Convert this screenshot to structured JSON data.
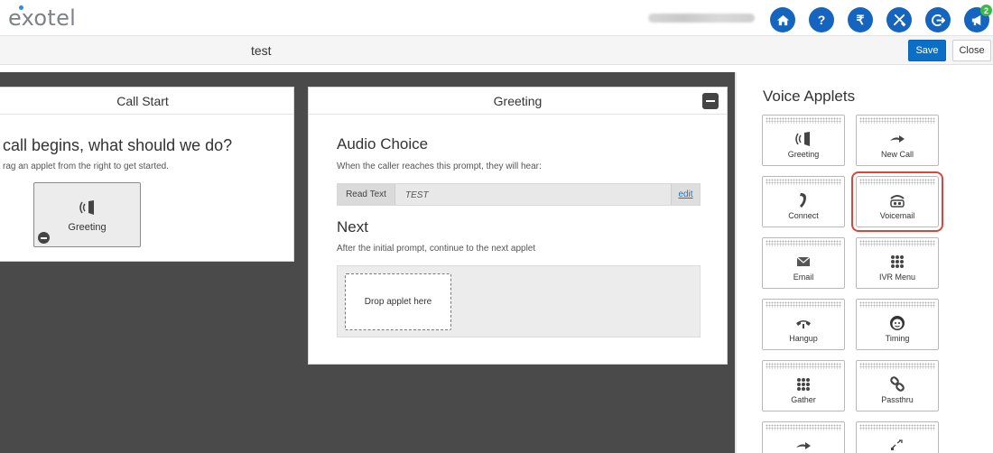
{
  "header": {
    "logo_text": "exotel",
    "user_name": "redacted user name",
    "icons": [
      {
        "name": "home-icon",
        "glyph": "home"
      },
      {
        "name": "help-icon",
        "glyph": "?"
      },
      {
        "name": "rupee-icon",
        "glyph": "₹"
      },
      {
        "name": "tools-icon",
        "glyph": "tools"
      },
      {
        "name": "logout-icon",
        "glyph": "logout"
      },
      {
        "name": "announcement-icon",
        "glyph": "megaphone",
        "badge": "2"
      }
    ],
    "accent_color": "#1565c0"
  },
  "titlebar": {
    "flow_name": "test",
    "save_label": "Save",
    "close_label": "Close"
  },
  "call_start": {
    "title": "Call Start",
    "question": "call begins, what should we do?",
    "hint": "rag an applet from the right to get started.",
    "applet_label": "Greeting"
  },
  "greeting": {
    "title": "Greeting",
    "audio_title": "Audio Choice",
    "audio_desc": "When the caller reaches this prompt, they will hear:",
    "read_label": "Read Text",
    "read_value": "TEST",
    "edit_label": "edit",
    "next_title": "Next",
    "next_desc": "After the initial prompt, continue to the next applet",
    "drop_label": "Drop applet here"
  },
  "palette": {
    "title": "Voice Applets",
    "selected_color": "#d9473a",
    "tiles": [
      {
        "label": "Greeting",
        "icon": "greeting-icon"
      },
      {
        "label": "New Call",
        "icon": "new-call-icon"
      },
      {
        "label": "Connect",
        "icon": "connect-icon"
      },
      {
        "label": "Voicemail",
        "icon": "voicemail-icon",
        "selected": true
      },
      {
        "label": "Email",
        "icon": "email-icon"
      },
      {
        "label": "IVR Menu",
        "icon": "ivr-menu-icon"
      },
      {
        "label": "Hangup",
        "icon": "hangup-icon"
      },
      {
        "label": "Timing",
        "icon": "timing-icon"
      },
      {
        "label": "Gather",
        "icon": "gather-icon"
      },
      {
        "label": "Passthru",
        "icon": "passthru-icon"
      },
      {
        "label": "",
        "icon": "forward-icon"
      },
      {
        "label": "",
        "icon": "transfer-icon"
      }
    ]
  }
}
